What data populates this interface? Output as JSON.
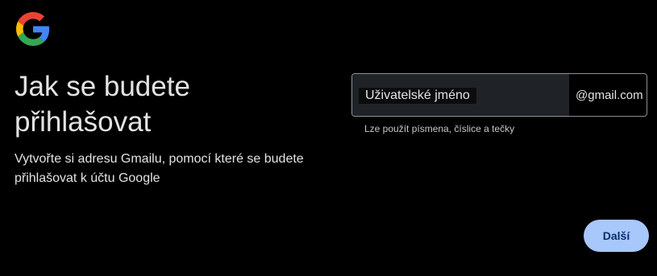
{
  "brand": {
    "logo_icon": "google-g-logo",
    "colors": {
      "blue": "#4285F4",
      "red": "#EA4335",
      "yellow": "#FBBC05",
      "green": "#34A853"
    }
  },
  "header": {
    "title": "Jak se budete přihlašovat",
    "subtitle": "Vytvořte si adresu Gmailu, pomocí které se budete přihlašovat k účtu Google"
  },
  "username_field": {
    "label": "Uživatelské jméno",
    "value": "",
    "suffix": "@gmail.com",
    "hint": "Lze použít písmena, číslice a tečky"
  },
  "actions": {
    "next_label": "Další",
    "next_color": "#a8c7fa"
  }
}
